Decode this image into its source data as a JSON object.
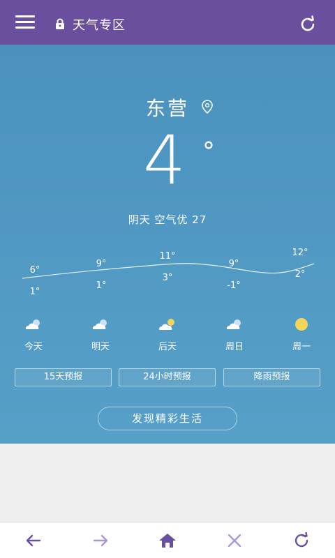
{
  "header": {
    "title": "天气专区",
    "icons": [
      "menu-icon",
      "lock-icon",
      "refresh-icon"
    ]
  },
  "weather": {
    "city": "东营",
    "temperature": "4",
    "degree_symbol": "°",
    "condition": "阴天  空气优 27"
  },
  "forecast": [
    {
      "day": "今天",
      "high": "6°",
      "low": "1°",
      "icon": "cloudy-icon"
    },
    {
      "day": "明天",
      "high": "9°",
      "low": "1°",
      "icon": "cloudy-icon"
    },
    {
      "day": "后天",
      "high": "11°",
      "low": "3°",
      "icon": "partly-sunny-icon"
    },
    {
      "day": "周日",
      "high": "9°",
      "low": "-1°",
      "icon": "cloudy-icon"
    },
    {
      "day": "周一",
      "high": "12°",
      "low": "2°",
      "icon": "sunny-icon"
    }
  ],
  "buttons": {
    "forecast15": "15天预报",
    "forecast24": "24小时预报",
    "rain": "降雨预报",
    "discover": "发现精彩生活"
  },
  "colors": {
    "header": "#6a4f9e",
    "sky": "#4f97c3",
    "sun": "#f1d65a",
    "nav_icon": "#6a4f9e"
  },
  "bottom_nav": [
    "back-icon",
    "forward-icon",
    "home-icon",
    "close-icon",
    "refresh-icon"
  ]
}
